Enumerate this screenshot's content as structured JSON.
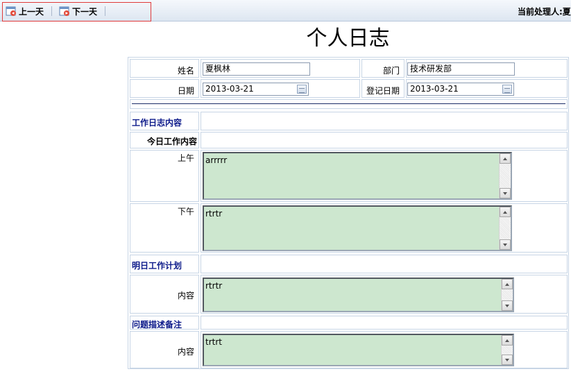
{
  "toolbar": {
    "prev_day": "上一天",
    "next_day": "下一天",
    "current_handler": "当前处理人:夏"
  },
  "page_title": "个人日志",
  "form": {
    "name_label": "姓名",
    "name_value": "夏枫林",
    "dept_label": "部门",
    "dept_value": "技术研发部",
    "date_label": "日期",
    "date_value": "2013-03-21",
    "reg_date_label": "登记日期",
    "reg_date_value": "2013-03-21",
    "work_log_section": "工作日志内容",
    "today_work": "今日工作内容",
    "morning_label": "上午",
    "morning_value": "arrrrr",
    "afternoon_label": "下午",
    "afternoon_value": "rtrtr",
    "tomorrow_section": "明日工作计划",
    "tomorrow_content_label": "内容",
    "tomorrow_content_value": "rtrtr",
    "issues_section": "问题描述备注",
    "issues_content_label": "内容",
    "issues_content_value": "trtrt"
  },
  "colors": {
    "section_title": "#0c1a8a",
    "textarea_bg": "#cde7cf",
    "table_border": "#c7d5e5",
    "toolbar_highlight": "#e03a3a"
  }
}
